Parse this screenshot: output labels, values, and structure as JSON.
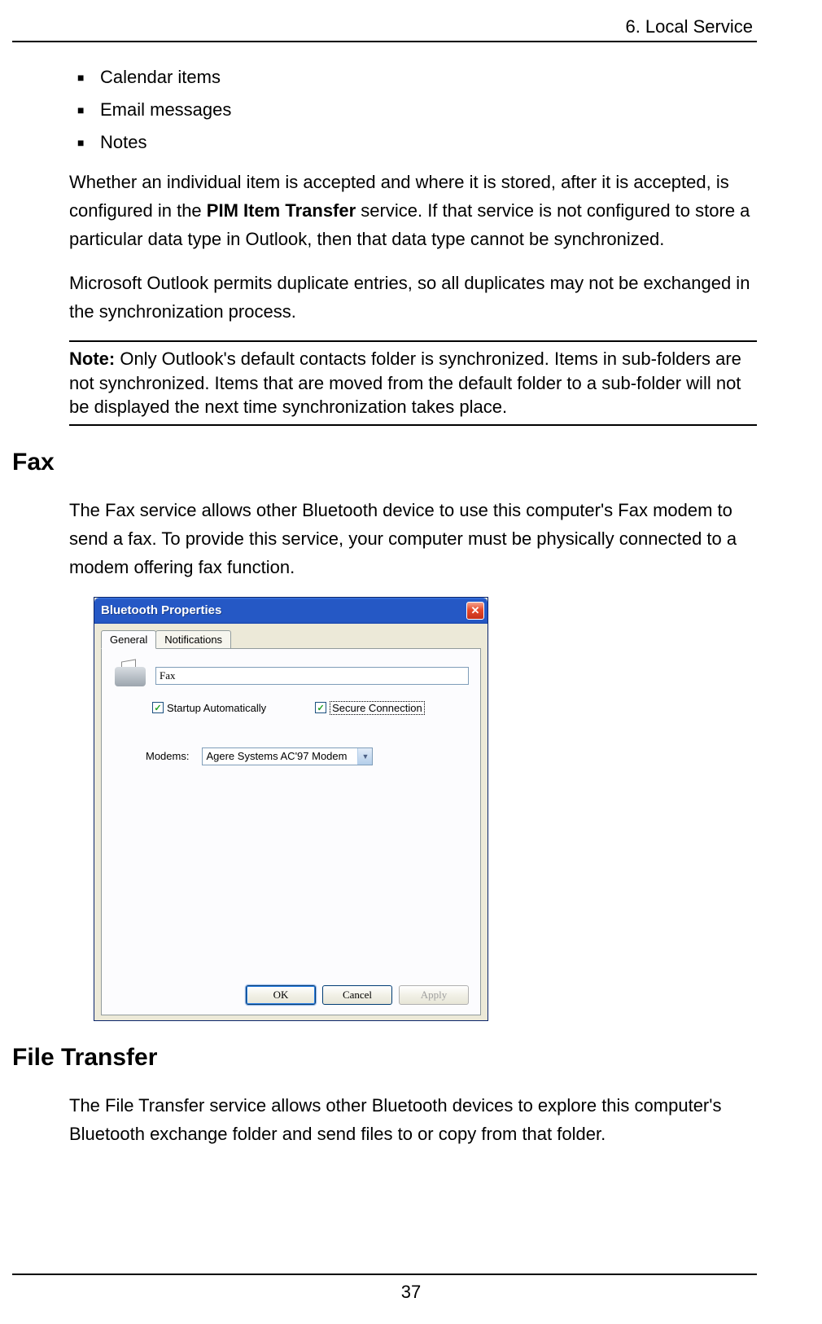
{
  "header": {
    "chapter": "6. Local Service"
  },
  "bullets": [
    "Calendar items",
    "Email messages",
    "Notes"
  ],
  "para1_pre": "Whether an individual item is accepted and where it is stored, after it is accepted, is configured in the ",
  "para1_bold": "PIM Item Transfer",
  "para1_post": " service. If that service is not configured to store a particular data type in Outlook, then that data type cannot be synchronized.",
  "para2": "Microsoft Outlook permits duplicate entries, so all duplicates may not be exchanged in the synchronization process.",
  "note_label": "Note:",
  "note_text": " Only Outlook's default contacts folder is synchronized. Items in sub-folders are not synchronized. Items that are moved from the default folder to a sub-folder will not be displayed the next time synchronization takes place.",
  "h_fax": "Fax",
  "para_fax": "The Fax service allows other Bluetooth device to use this computer's Fax modem to send a fax. To provide this service, your computer must be physically connected to a modem offering fax function.",
  "dialog": {
    "title": "Bluetooth Properties",
    "tabs": [
      "General",
      "Notifications"
    ],
    "service_name": "Fax",
    "chk_startup": "Startup Automatically",
    "chk_secure": "Secure Connection",
    "modems_label": "Modems:",
    "modem_value": "Agere Systems AC'97 Modem",
    "btn_ok": "OK",
    "btn_cancel": "Cancel",
    "btn_apply": "Apply"
  },
  "h_ft": "File Transfer",
  "para_ft": "The File Transfer service allows other Bluetooth devices to explore this computer's Bluetooth exchange folder and send files to or copy from that folder.",
  "page_num": "37"
}
